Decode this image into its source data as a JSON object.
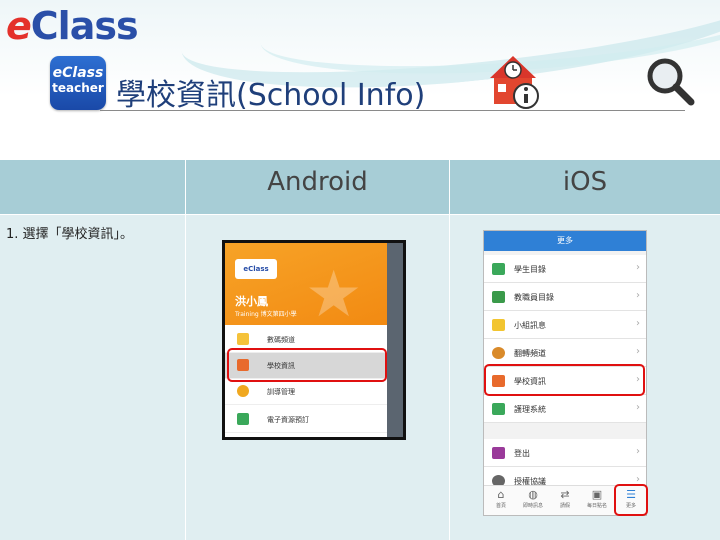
{
  "header": {
    "brand_e": "e",
    "brand_rest": "Class",
    "badge_line1": "eClass",
    "badge_line2": "teacher",
    "title": "學校資訊(School Info)",
    "icons": [
      "eclass-logo",
      "school-info-icon",
      "search-icon"
    ]
  },
  "table": {
    "columns": [
      "",
      "Android",
      "iOS"
    ],
    "steps": [
      {
        "text": "1. 選擇「學校資訊」。"
      }
    ]
  },
  "android": {
    "user_name": "洪小鳳",
    "user_sub": "Training 博文第四小學",
    "logo_text": "eClass",
    "menu": [
      {
        "label": "數碼頻道",
        "icon": "video-icon",
        "color": "#f5c23a"
      },
      {
        "label": "學校資訊",
        "icon": "school-info-icon",
        "color": "#e86a2c",
        "highlighted": true
      },
      {
        "label": "訓導管理",
        "icon": "medal-icon",
        "color": "#f0a820"
      },
      {
        "label": "電子資源預訂",
        "icon": "calendar-icon",
        "color": "#3aa85a"
      }
    ]
  },
  "ios": {
    "nav_title": "更多",
    "rows": [
      {
        "label": "學生目錄",
        "icon": "clipboard-icon",
        "color": "#3aa85a"
      },
      {
        "label": "教職員目錄",
        "icon": "id-card-icon",
        "color": "#3a9a4a"
      },
      {
        "label": "小組訊息",
        "icon": "message-icon",
        "color": "#f2c530"
      },
      {
        "label": "翻轉頻道",
        "icon": "users-icon",
        "color": "#d98a2a"
      },
      {
        "label": "學校資訊",
        "icon": "school-info-icon",
        "color": "#e86a2c",
        "highlighted": true
      },
      {
        "label": "護理系統",
        "icon": "medical-icon",
        "color": "#3aa85a"
      },
      {
        "label": "登出",
        "icon": "logout-icon",
        "color": "#9a3a9a"
      },
      {
        "label": "授權協議",
        "icon": "person-icon",
        "color": "#666666"
      }
    ],
    "tabs": [
      {
        "label": "首頁",
        "icon": "home-icon",
        "glyph": "⌂"
      },
      {
        "label": "即時訊息",
        "icon": "chat-icon",
        "glyph": "◍"
      },
      {
        "label": "請假",
        "icon": "transfer-icon",
        "glyph": "⇄"
      },
      {
        "label": "每日點名",
        "icon": "checkin-icon",
        "glyph": "▣"
      },
      {
        "label": "更多",
        "icon": "menu-icon",
        "glyph": "☰",
        "highlighted": true
      }
    ]
  },
  "colors": {
    "header_cell": "#a7cdd6",
    "body_cell": "#e0eef1",
    "highlight": "#e01010",
    "title_text": "#1f3f7a"
  }
}
